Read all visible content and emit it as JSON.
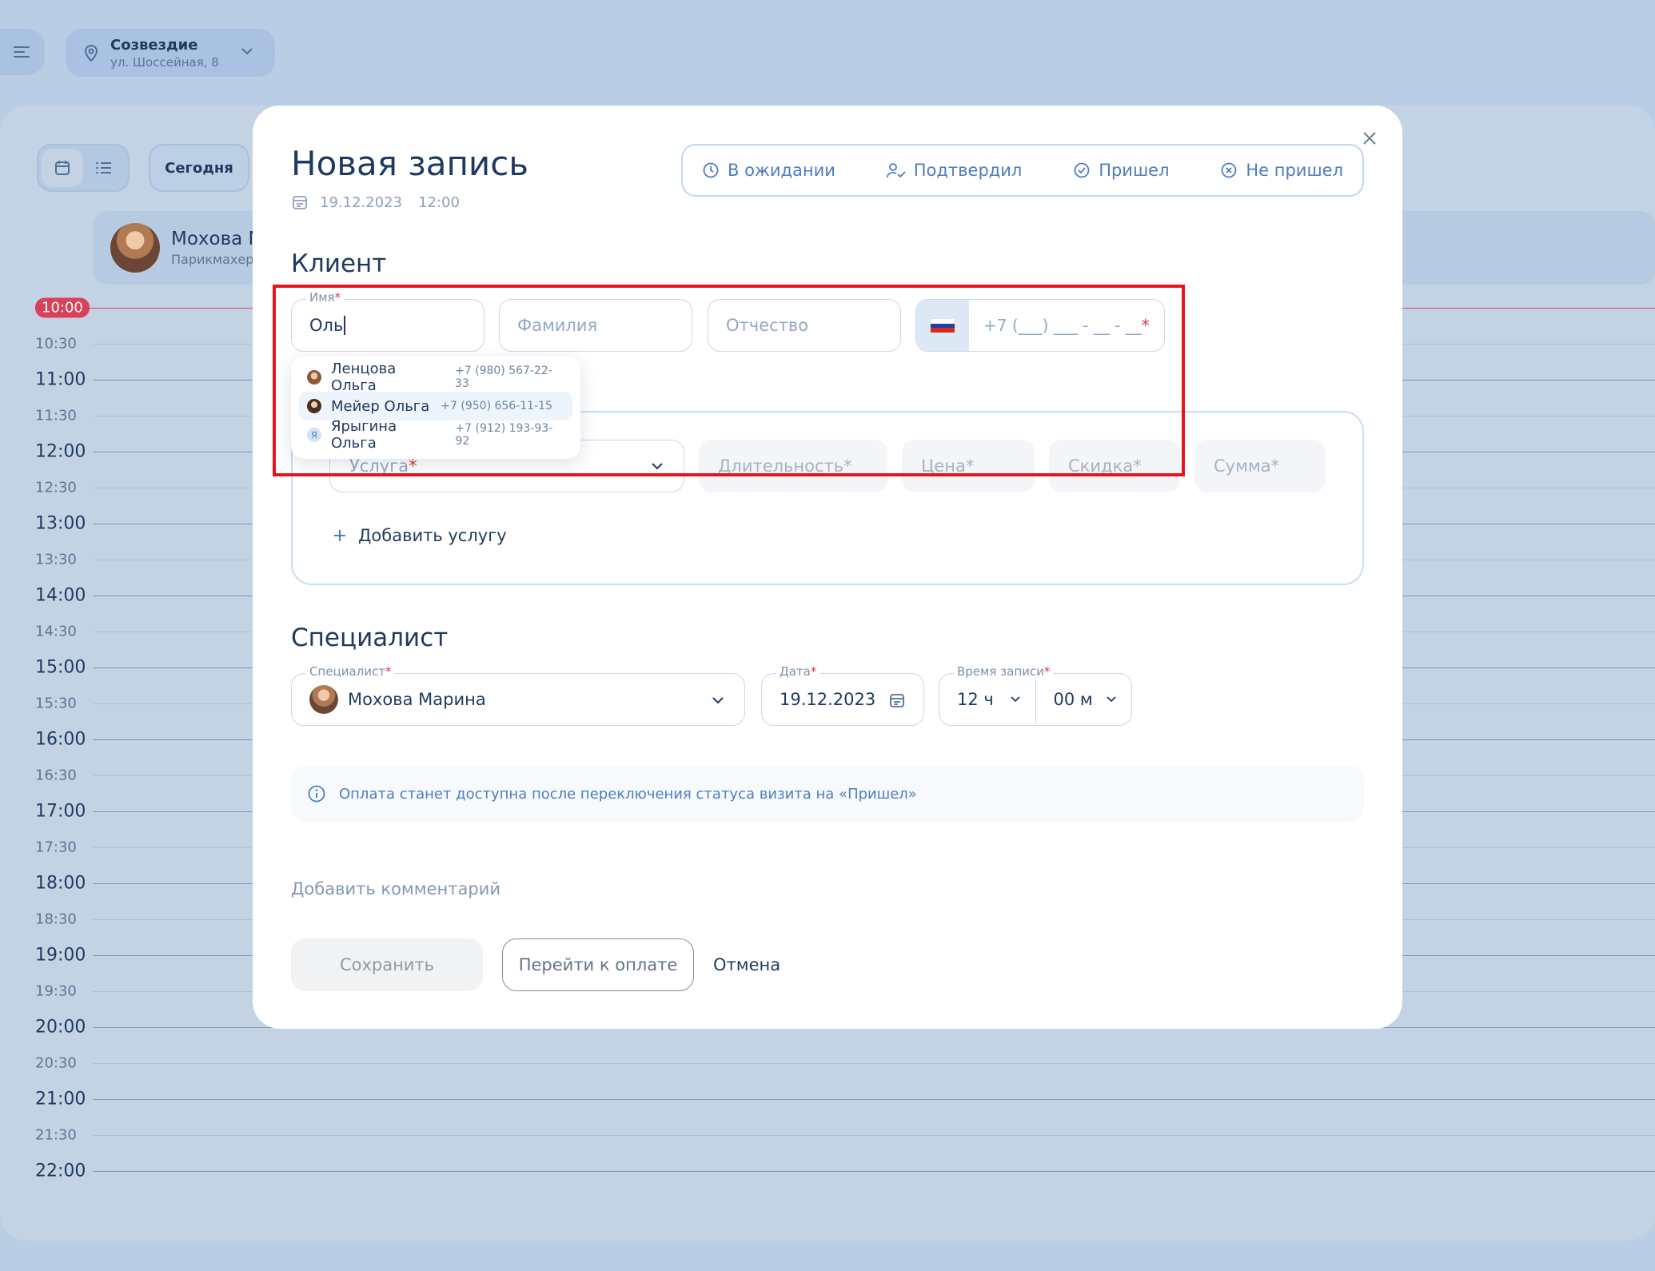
{
  "location": {
    "name": "Созвездие",
    "address": "ул. Шоссейная, 8"
  },
  "toolbar": {
    "today_label": "Сегодня"
  },
  "specialist_card": {
    "name": "Мохова М",
    "role": "Парикмахер"
  },
  "timeline": {
    "now_label": "10:00",
    "slots": [
      "10:30",
      "11:00",
      "11:30",
      "12:00",
      "12:30",
      "13:00",
      "13:30",
      "14:00",
      "14:30",
      "15:00",
      "15:30",
      "16:00",
      "16:30",
      "17:00",
      "17:30",
      "18:00",
      "18:30",
      "19:00",
      "19:30",
      "20:00",
      "20:30",
      "21:00",
      "21:30",
      "22:00"
    ]
  },
  "modal": {
    "title": "Новая запись",
    "date": "19.12.2023",
    "time": "12:00",
    "statuses": [
      {
        "label": "В ожидании",
        "icon": "clock-icon"
      },
      {
        "label": "Подтвердил",
        "icon": "user-check-icon"
      },
      {
        "label": "Пришел",
        "icon": "check-circle-icon"
      },
      {
        "label": "Не пришел",
        "icon": "x-circle-icon"
      }
    ],
    "client": {
      "section_title": "Клиент",
      "first_name_label": "Имя",
      "first_name_value": "Оль",
      "last_name_placeholder": "Фамилия",
      "patronymic_placeholder": "Отчество",
      "phone_placeholder": "+7 (___) ___ - __ - __"
    },
    "suggestions": [
      {
        "name": "Ленцова Ольга",
        "phone": "+7 (980) 567-22-33"
      },
      {
        "name": "Мейер Ольга",
        "phone": "+7 (950) 656-11-15"
      },
      {
        "name": "Ярыгина Ольга",
        "phone": "+7 (912) 193-93-92",
        "initial": "Я"
      }
    ],
    "services": {
      "service_placeholder": "Услуга",
      "duration_placeholder": "Длительность*",
      "price_placeholder": "Цена*",
      "discount_placeholder": "Скидка*",
      "sum_placeholder": "Сумма*",
      "add_label": "Добавить услугу"
    },
    "specialist": {
      "section_title": "Специалист",
      "specialist_label": "Специалист",
      "specialist_value": "Мохова Марина",
      "date_label": "Дата",
      "date_value": "19.12.2023",
      "time_label": "Время записи",
      "hours_value": "12 ч",
      "minutes_value": "00 м"
    },
    "info_text": "Оплата станет доступна после переключения статуса визита на «Пришел»",
    "comment_label": "Добавить комментарий",
    "buttons": {
      "save": "Сохранить",
      "pay": "Перейти к оплате",
      "cancel": "Отмена"
    }
  },
  "colors": {
    "accent": "#4e7cc0",
    "highlight": "#e8141c",
    "now_line": "#d9405a",
    "required": "#e0304a"
  }
}
